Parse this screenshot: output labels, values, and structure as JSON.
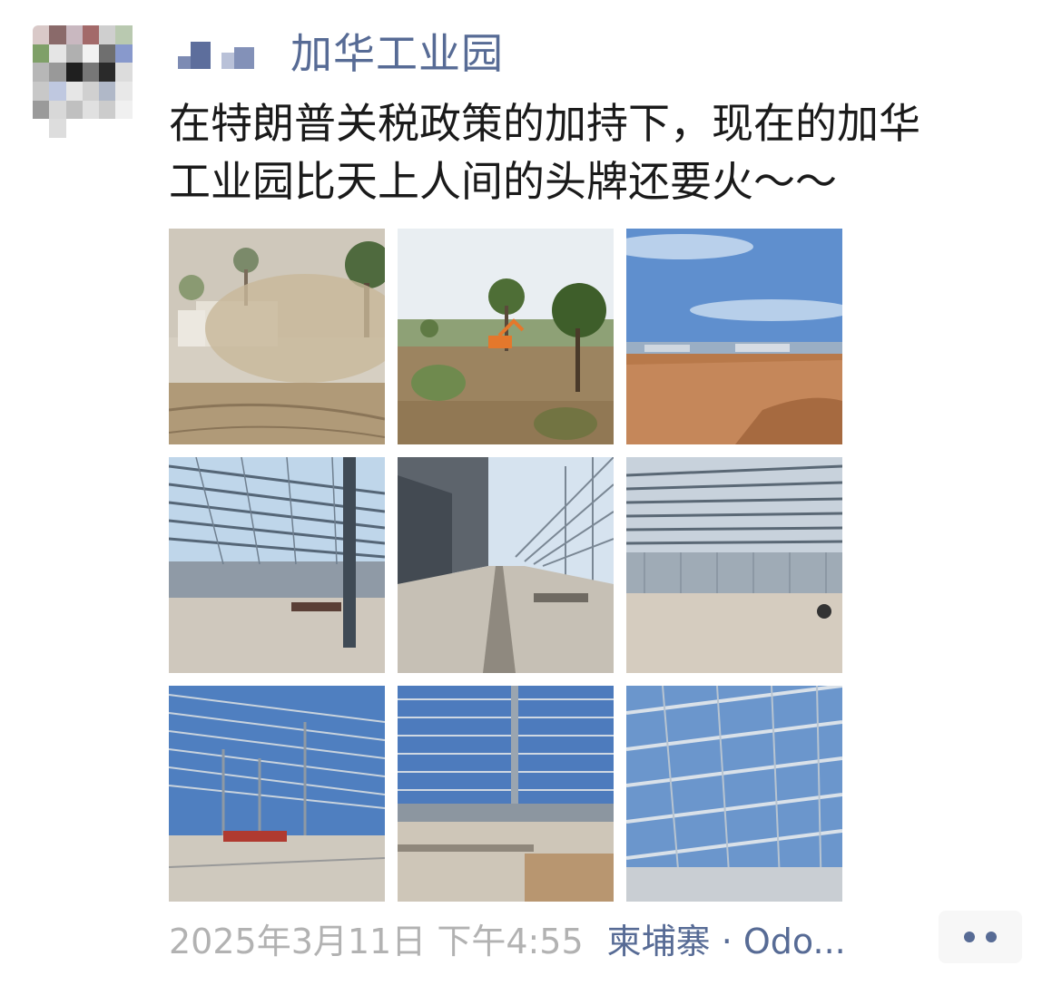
{
  "post": {
    "username": "加华工业园",
    "content": "在特朗普关税政策的加持下，现在的加华\n工业园比天上人间的头牌还要火～～",
    "timestamp": "2025年3月11日 下午4:55",
    "location": "柬埔寨 · Odo..."
  },
  "photos": [
    {
      "label": "dusty-construction-site"
    },
    {
      "label": "land-clearing-excavator"
    },
    {
      "label": "cleared-red-soil-field"
    },
    {
      "label": "steel-frame-warehouse-1"
    },
    {
      "label": "steel-frame-corridor"
    },
    {
      "label": "steel-frame-warehouse-2"
    },
    {
      "label": "steel-roof-trusses-1"
    },
    {
      "label": "steel-roof-trusses-2"
    },
    {
      "label": "steel-roof-trusses-3"
    }
  ],
  "colors": {
    "link": "#576b95",
    "meta": "#b2b2b2",
    "text": "#1a1a1a"
  },
  "icons": {
    "more": "more-dots-icon"
  }
}
